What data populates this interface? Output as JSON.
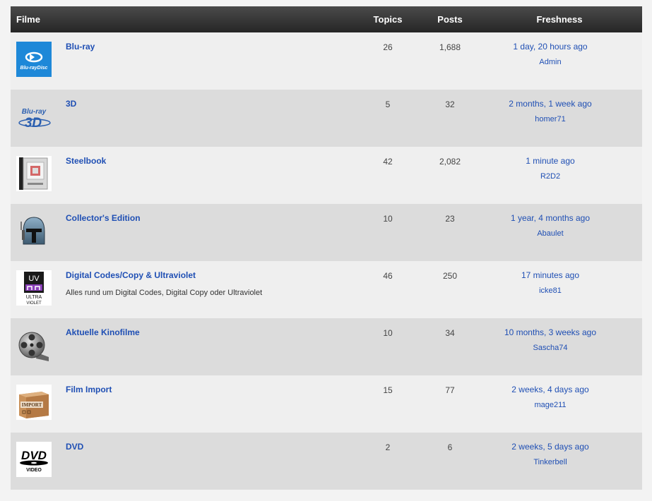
{
  "header": {
    "filme": "Filme",
    "topics": "Topics",
    "posts": "Posts",
    "freshness": "Freshness"
  },
  "forums": [
    {
      "title": "Blu-ray",
      "description": "",
      "topics": "26",
      "posts": "1,688",
      "freshness": "1 day, 20 hours ago",
      "author": "Admin",
      "icon": "bluray-disc-icon"
    },
    {
      "title": "3D",
      "description": "",
      "topics": "5",
      "posts": "32",
      "freshness": "2 months, 1 week ago",
      "author": "homer71",
      "icon": "bluray-3d-icon"
    },
    {
      "title": "Steelbook",
      "description": "",
      "topics": "42",
      "posts": "2,082",
      "freshness": "1 minute ago",
      "author": "R2D2",
      "icon": "steelbook-icon"
    },
    {
      "title": "Collector's Edition",
      "description": "",
      "topics": "10",
      "posts": "23",
      "freshness": "1 year, 4 months ago",
      "author": "Abaulet",
      "icon": "helmet-icon"
    },
    {
      "title": "Digital Codes/Copy & Ultraviolet",
      "description": "Alles rund um Digital Codes, Digital Copy oder Ultraviolet",
      "topics": "46",
      "posts": "250",
      "freshness": "17 minutes ago",
      "author": "icke81",
      "icon": "ultraviolet-icon"
    },
    {
      "title": "Aktuelle Kinofilme",
      "description": "",
      "topics": "10",
      "posts": "34",
      "freshness": "10 months, 3 weeks ago",
      "author": "Sascha74",
      "icon": "film-reel-icon"
    },
    {
      "title": "Film Import",
      "description": "",
      "topics": "15",
      "posts": "77",
      "freshness": "2 weeks, 4 days ago",
      "author": "mage211",
      "icon": "import-box-icon"
    },
    {
      "title": "DVD",
      "description": "",
      "topics": "2",
      "posts": "6",
      "freshness": "2 weeks, 5 days ago",
      "author": "Tinkerbell",
      "icon": "dvd-video-icon"
    }
  ],
  "icon_text": {
    "bluray": "Blu-rayDisc",
    "bluray3d_top": "Blu-ray",
    "bluray3d_big": "3D",
    "uv_top": "UV",
    "uv_line1": "ULTRA",
    "uv_line2": "VIOLET",
    "import": "IMPORT",
    "dvd": "DVD",
    "dvd_video": "VIDEO"
  },
  "colors": {
    "link": "#1f4fb4",
    "header_bg": "#333333",
    "row_odd": "#efefef",
    "row_even": "#dcdcdc"
  }
}
